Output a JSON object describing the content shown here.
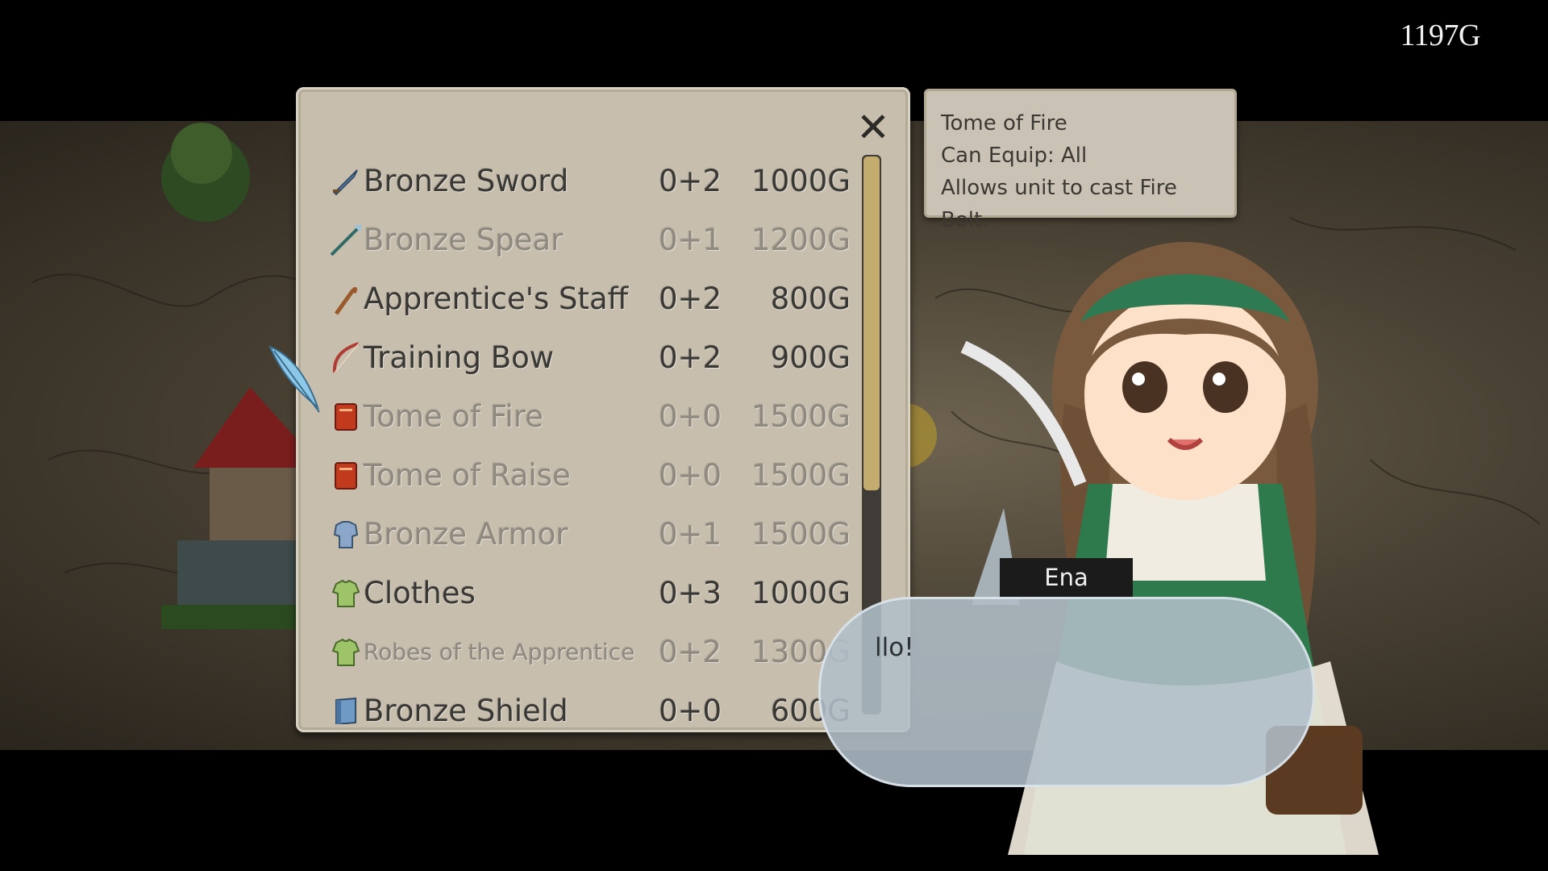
{
  "hud": {
    "gold": "1197G"
  },
  "shop": {
    "close_glyph": "✕",
    "items": [
      {
        "name": "Bronze Sword",
        "bonus": "0+2",
        "price": "1000G",
        "enabled": true,
        "icon": "sword-icon"
      },
      {
        "name": "Bronze Spear",
        "bonus": "0+1",
        "price": "1200G",
        "enabled": false,
        "icon": "spear-icon"
      },
      {
        "name": "Apprentice's Staff",
        "bonus": "0+2",
        "price": "800G",
        "enabled": true,
        "icon": "staff-icon"
      },
      {
        "name": "Training Bow",
        "bonus": "0+2",
        "price": "900G",
        "enabled": true,
        "icon": "bow-icon"
      },
      {
        "name": "Tome of Fire",
        "bonus": "0+0",
        "price": "1500G",
        "enabled": false,
        "icon": "tome-icon"
      },
      {
        "name": "Tome of Raise",
        "bonus": "0+0",
        "price": "1500G",
        "enabled": false,
        "icon": "tome-icon"
      },
      {
        "name": "Bronze Armor",
        "bonus": "0+1",
        "price": "1500G",
        "enabled": false,
        "icon": "armor-icon"
      },
      {
        "name": "Clothes",
        "bonus": "0+3",
        "price": "1000G",
        "enabled": true,
        "icon": "clothes-icon"
      },
      {
        "name": "Robes of the Apprentice",
        "bonus": "0+2",
        "price": "1300G",
        "enabled": false,
        "icon": "clothes-icon"
      },
      {
        "name": "Bronze Shield",
        "bonus": "0+0",
        "price": "600G",
        "enabled": true,
        "icon": "shield-icon"
      }
    ],
    "scroll_fraction_visible": 0.6
  },
  "tooltip": {
    "title": "Tome of Fire",
    "equip": "Can Equip: All",
    "description": "Allows unit to cast Fire Bolt."
  },
  "dialogue": {
    "speaker": "Ena",
    "text": "llo!"
  },
  "colors": {
    "panel": "#c7bead",
    "scroll_thumb": "#c4ac6f",
    "enabled_text": "#3a3835",
    "disabled_text": "#8f897f"
  }
}
